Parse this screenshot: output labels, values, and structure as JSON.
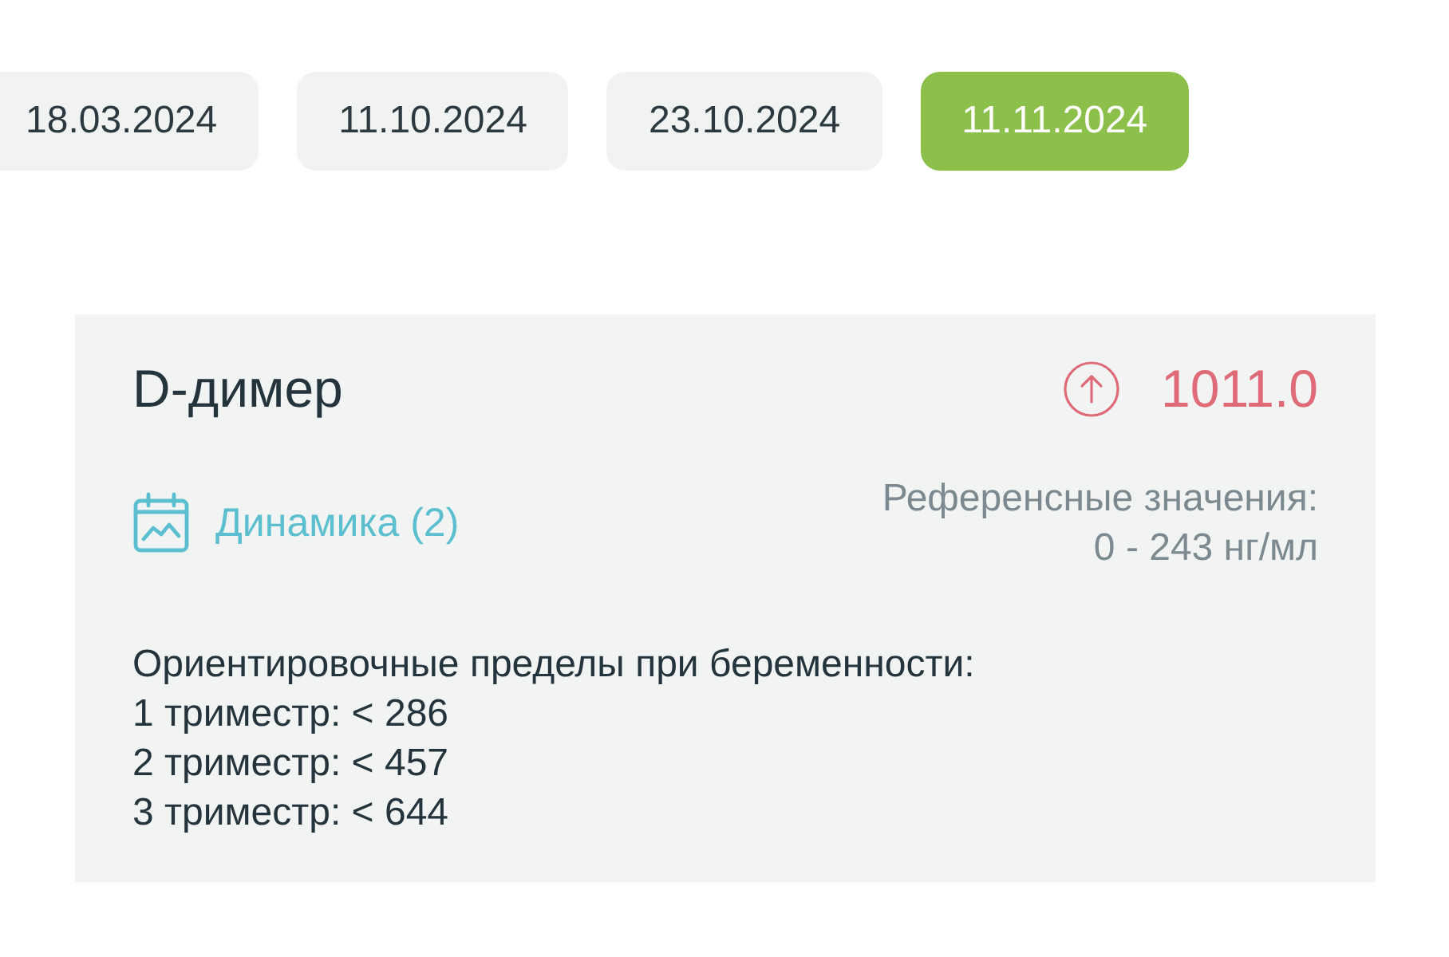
{
  "dates": [
    {
      "label": "18.03.2024",
      "selected": false
    },
    {
      "label": "11.10.2024",
      "selected": false
    },
    {
      "label": "23.10.2024",
      "selected": false
    },
    {
      "label": "11.11.2024",
      "selected": true
    }
  ],
  "result": {
    "name": "D-димер",
    "above_reference": true,
    "value": "1011.0",
    "dynamics_link": "Динамика (2)",
    "reference_label": "Референсные значения:",
    "reference_range": "0 - 243 нг/мл",
    "notes": [
      "Ориентировочные пределы при беременности:",
      "1 триместр: < 286",
      "2 триместр: < 457",
      "3 триместр: < 644"
    ]
  }
}
